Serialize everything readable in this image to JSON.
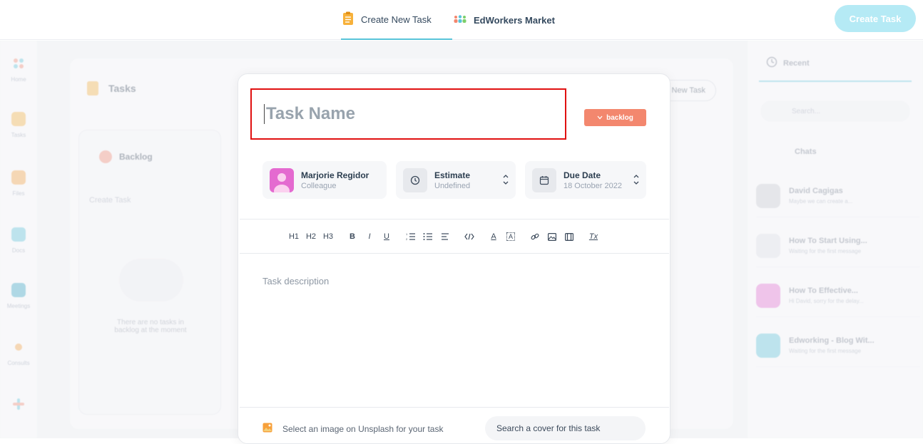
{
  "topbar": {
    "tabs": [
      {
        "label": "Create New Task",
        "icon": "clipboard-icon",
        "active": true
      },
      {
        "label": "EdWorkers Market",
        "icon": "people-icon",
        "active": false
      }
    ],
    "create_button": "Create Task"
  },
  "background": {
    "sidebar": [
      {
        "label": "Home"
      },
      {
        "label": "Tasks"
      },
      {
        "label": "Files"
      },
      {
        "label": "Docs"
      },
      {
        "label": "Meetings"
      },
      {
        "label": "Consults"
      }
    ],
    "tasks_panel": {
      "title": "Tasks",
      "new_task": "New Task",
      "column_title": "Backlog",
      "create_task": "Create Task",
      "empty_text": "There are no tasks in backlog at the moment"
    },
    "right_panel": {
      "tab": "Recent",
      "search_placeholder": "Search...",
      "section": "Chats",
      "chats": [
        {
          "title": "David Cagigas",
          "sub": "Maybe we can create a..."
        },
        {
          "title": "How To Start Using...",
          "sub": "Waiting for the first message"
        },
        {
          "title": "How To Effective...",
          "sub": "Hi David, sorry for the delay..."
        },
        {
          "title": "Edworking - Blog Wit...",
          "sub": "Waiting for the first message"
        }
      ]
    }
  },
  "modal": {
    "task_name_placeholder": "Task Name",
    "status_badge": "backlog",
    "assignee": {
      "name": "Marjorie Regidor",
      "role": "Colleague"
    },
    "estimate": {
      "label": "Estimate",
      "value": "Undefined"
    },
    "due_date": {
      "label": "Due Date",
      "value": "18 October 2022"
    },
    "toolbar": {
      "h1": "H1",
      "h2": "H2",
      "h3": "H3",
      "bold": "B",
      "italic": "I",
      "underline": "U",
      "text_color": "A",
      "text_bg": "A",
      "clear_format": "Tx"
    },
    "description_placeholder": "Task description",
    "unsplash_text": "Select an image on Unsplash for your task",
    "search_cover": "Search a cover for this task"
  },
  "colors": {
    "accent": "#58c4d9",
    "badge": "#f3876e",
    "highlight": "#e01010"
  }
}
